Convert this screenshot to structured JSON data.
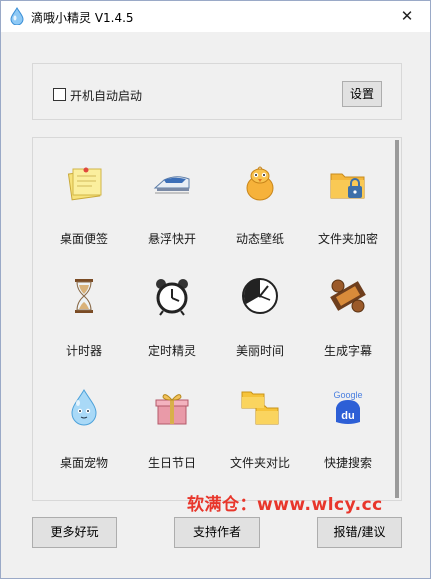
{
  "window": {
    "title": "滴哦小精灵 V1.4.5",
    "close_glyph": "✕"
  },
  "settings_panel": {
    "autostart_label": "开机自动启动",
    "autostart_checked": false,
    "settings_button": "设置"
  },
  "tools": [
    {
      "label": "桌面便签",
      "icon": "sticky-note-icon"
    },
    {
      "label": "悬浮快开",
      "icon": "bullet-train-icon"
    },
    {
      "label": "动态壁纸",
      "icon": "chick-icon"
    },
    {
      "label": "文件夹加密",
      "icon": "locked-folder-icon"
    },
    {
      "label": "计时器",
      "icon": "hourglass-icon"
    },
    {
      "label": "定时精灵",
      "icon": "alarm-clock-icon"
    },
    {
      "label": "美丽时间",
      "icon": "artistic-clock-icon"
    },
    {
      "label": "生成字幕",
      "icon": "film-reel-icon"
    },
    {
      "label": "桌面宠物",
      "icon": "water-drop-pet-icon"
    },
    {
      "label": "生日节日",
      "icon": "gift-box-icon"
    },
    {
      "label": "文件夹对比",
      "icon": "folder-compare-icon"
    },
    {
      "label": "快捷搜索",
      "icon": "search-engines-icon"
    }
  ],
  "icon_text": {
    "search_engine_top": "Google",
    "search_engine_bottom": "du"
  },
  "watermark": "软满仓：www.wlcy.cc",
  "footer": {
    "more_label": "更多好玩",
    "support_label": "支持作者",
    "report_label": "报错/建议"
  }
}
